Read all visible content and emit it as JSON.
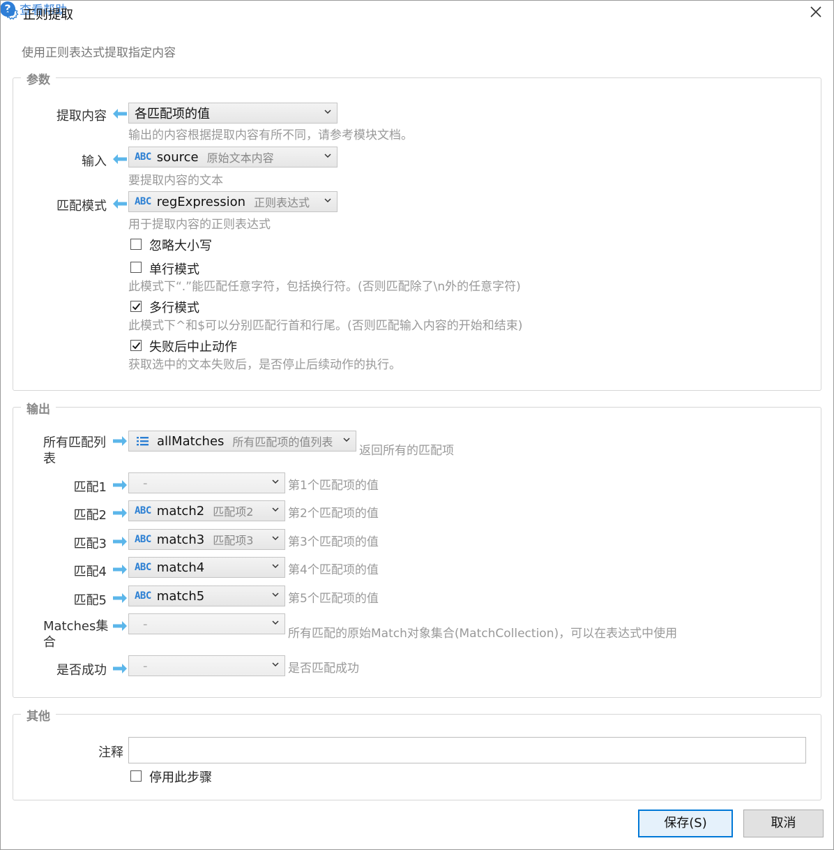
{
  "window": {
    "title": "正则提取",
    "subtitle": "使用正则表达式提取指定内容",
    "help_label": "查看帮助"
  },
  "params": {
    "title": "参数",
    "extract": {
      "label": "提取内容",
      "value": "各匹配项的值",
      "hint": "输出的内容根据提取内容有所不同，请参考模块文档。"
    },
    "input": {
      "label": "输入",
      "type_icon": "ABC",
      "value": "source",
      "desc": "原始文本内容",
      "hint": "要提取内容的文本"
    },
    "pattern": {
      "label": "匹配模式",
      "type_icon": "ABC",
      "value": "regExpression",
      "desc": "正则表达式",
      "hint": "用于提取内容的正则表达式"
    },
    "ignore_case": {
      "label": "忽略大小写",
      "checked": false
    },
    "single_line": {
      "label": "单行模式",
      "checked": false,
      "hint": "此模式下“.”能匹配任意字符，包括换行符。(否则匹配除了\\n外的任意字符)"
    },
    "multi_line": {
      "label": "多行模式",
      "checked": true,
      "hint": "此模式下^和$可以分别匹配行首和行尾。(否则匹配输入内容的开始和结束)"
    },
    "stop_on_fail": {
      "label": "失败后中止动作",
      "checked": true,
      "hint": "获取选中的文本失败后，是否停止后续动作的执行。"
    }
  },
  "output": {
    "title": "输出",
    "all_matches": {
      "label_line1": "所有匹配列",
      "label_line2": "表",
      "value": "allMatches",
      "desc": "所有匹配项的值列表",
      "hint": "返回所有的匹配项"
    },
    "match1": {
      "label": "匹配1",
      "value": "-",
      "hint": "第1个匹配项的值"
    },
    "match2": {
      "label": "匹配2",
      "type_icon": "ABC",
      "value": "match2",
      "desc": "匹配项2",
      "hint": "第2个匹配项的值"
    },
    "match3": {
      "label": "匹配3",
      "type_icon": "ABC",
      "value": "match3",
      "desc": "匹配项3",
      "hint": "第3个匹配项的值"
    },
    "match4": {
      "label": "匹配4",
      "type_icon": "ABC",
      "value": "match4",
      "hint": "第4个匹配项的值"
    },
    "match5": {
      "label": "匹配5",
      "type_icon": "ABC",
      "value": "match5",
      "hint": "第5个匹配项的值"
    },
    "matches_coll": {
      "label_line1": "Matches集",
      "label_line2": "合",
      "value": "-",
      "hint": "所有匹配的原始Match对象集合(MatchCollection)，可以在表达式中使用"
    },
    "success": {
      "label": "是否成功",
      "value": "-",
      "hint": "是否匹配成功"
    }
  },
  "other": {
    "title": "其他",
    "note": {
      "label": "注释",
      "value": ""
    },
    "disable": {
      "label": "停用此步骤",
      "checked": false
    }
  },
  "buttons": {
    "save": "保存(S)",
    "cancel": "取消"
  },
  "colors": {
    "accent": "#2b7fd3",
    "arrow": "#5bb6ea",
    "primary_border": "#0078d7"
  }
}
